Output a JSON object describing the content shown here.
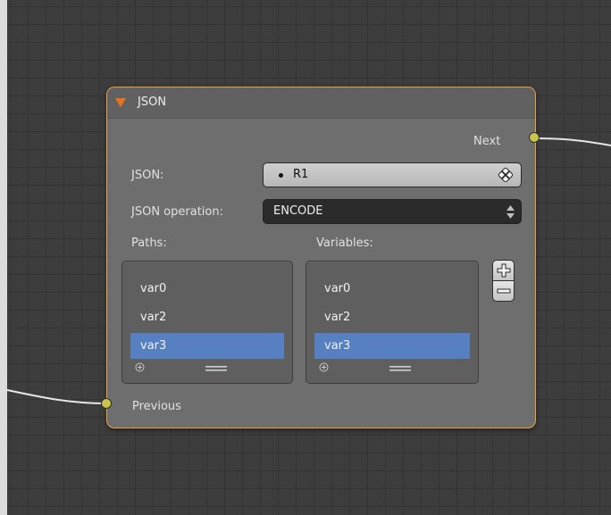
{
  "node": {
    "title": "JSON",
    "outputs": {
      "next_label": "Next"
    },
    "inputs": {
      "previous_label": "Previous"
    },
    "fields": {
      "json_label": "JSON:",
      "json_value": "R1",
      "operation_label": "JSON operation:",
      "operation_value": "ENCODE"
    },
    "lists": {
      "paths_label": "Paths:",
      "variables_label": "Variables:",
      "paths": [
        "var0",
        "var2",
        "var3"
      ],
      "variables": [
        "var0",
        "var2",
        "var3"
      ],
      "selected_path": "var3",
      "selected_variable": "var3"
    }
  },
  "icons": {
    "collapse": "triangle-down-icon",
    "clear": "x-clear-icon",
    "spinner": "up-down-arrows-icon",
    "add_item": "plus-icon",
    "remove_item": "minus-icon",
    "list_add": "small-plus-icon",
    "list_grip": "drag-grip-icon"
  },
  "colors": {
    "canvas": "#3d3d3d",
    "node_body": "#6e6e6e",
    "node_border": "#e8a23d",
    "socket": "#c9c54a",
    "selection": "#5680c2"
  }
}
